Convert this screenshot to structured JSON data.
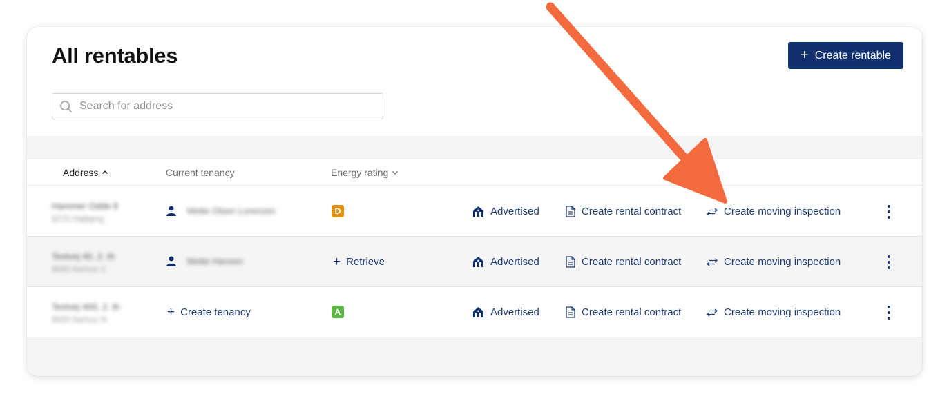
{
  "page": {
    "title": "All rentables",
    "create_button": "Create rentable"
  },
  "search": {
    "placeholder": "Search for address"
  },
  "table": {
    "headers": {
      "address": "Address",
      "tenancy": "Current tenancy",
      "energy": "Energy rating"
    },
    "rows": [
      {
        "address_line1": "Hammer Odde 8",
        "address_line2": "8270 Højbjerg",
        "tenant": "Mette Olsen Lorenzen",
        "energy": "D",
        "energy_color": "#e0910f"
      },
      {
        "address_line1": "Testvej 40, 2. th",
        "address_line2": "8000 Aarhus C",
        "tenant": "Mette Hansen",
        "energy_action": "Retrieve"
      },
      {
        "address_line1": "Testvej 400, 2. th",
        "address_line2": "8000 Aarhus N",
        "tenancy_action": "Create tenancy",
        "energy": "A",
        "energy_color": "#5bb547"
      }
    ],
    "actions": {
      "advertised": "Advertised",
      "contract": "Create rental contract",
      "inspection": "Create moving inspection"
    }
  },
  "colors": {
    "primary": "#10306e",
    "link": "#1f3d74",
    "annotation_arrow": "#f26a3d"
  },
  "icons": [
    "search-icon",
    "person-icon",
    "plus-icon",
    "house-icon",
    "document-icon",
    "swap-arrows-icon",
    "kebab-icon",
    "chevron-up-icon",
    "chevron-down-icon"
  ]
}
